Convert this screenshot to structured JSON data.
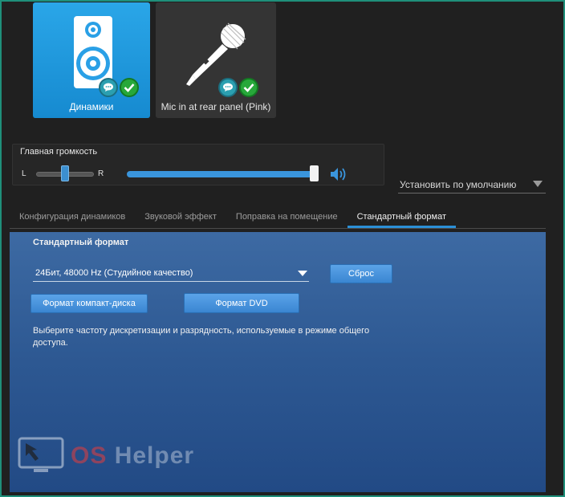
{
  "devices": [
    {
      "label": "Динамики",
      "icon": "speaker-icon",
      "active": true
    },
    {
      "label": "Mic in at rear panel (Pink)",
      "icon": "microphone-icon",
      "active": false
    }
  ],
  "volume": {
    "title": "Главная громкость",
    "balance_left": "L",
    "balance_right": "R",
    "balance_value": 0.5,
    "level": 0.98
  },
  "default_select": {
    "label": "Установить по умолчанию"
  },
  "tabs": [
    {
      "label": "Конфигурация динамиков",
      "active": false
    },
    {
      "label": "Звуковой эффект",
      "active": false
    },
    {
      "label": "Поправка на помещение",
      "active": false
    },
    {
      "label": "Стандартный формат",
      "active": true
    }
  ],
  "content": {
    "title": "Стандартный формат",
    "format_value": "24Бит, 48000 Hz (Студийное качество)",
    "reset_label": "Сброс",
    "cd_label": "Формат компакт-диска",
    "dvd_label": "Формат DVD",
    "description": "Выберите частоту дискретизации и разрядность, используемые в режиме общего доступа."
  },
  "watermark": {
    "prefix": "OS",
    "suffix": " Helper"
  },
  "colors": {
    "accent": "#2b8fd6",
    "ok": "#27a83a",
    "panel": "#2d5892"
  }
}
